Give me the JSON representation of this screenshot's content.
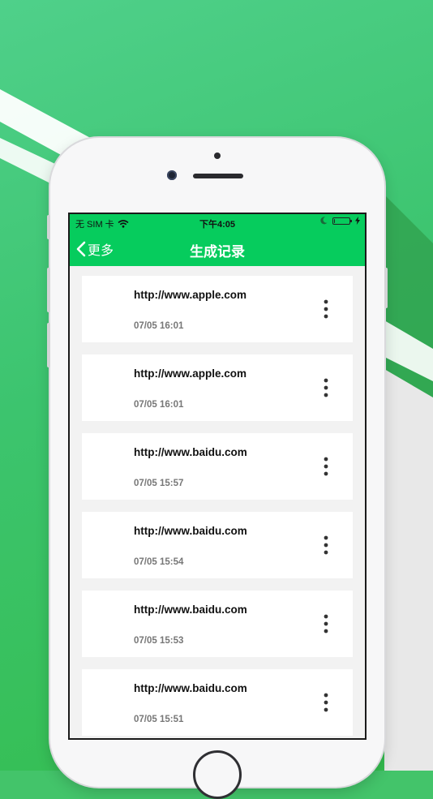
{
  "statusbar": {
    "carrier": "无 SIM 卡",
    "time": "下午4:05",
    "battery_level": 0.05
  },
  "navbar": {
    "back_label": "更多",
    "title": "生成记录"
  },
  "records": [
    {
      "url": "http://www.apple.com",
      "time": "07/05 16:01"
    },
    {
      "url": "http://www.apple.com",
      "time": "07/05 16:01"
    },
    {
      "url": "http://www.baidu.com",
      "time": "07/05 15:57"
    },
    {
      "url": "http://www.baidu.com",
      "time": "07/05 15:54"
    },
    {
      "url": "http://www.baidu.com",
      "time": "07/05 15:53"
    },
    {
      "url": "http://www.baidu.com",
      "time": "07/05 15:51"
    }
  ],
  "colors": {
    "accent": "#06cc5d",
    "background": "#43c46a",
    "card": "#ffffff",
    "list_bg": "#f2f2f2"
  },
  "icons": {
    "back": "chevron-left-icon",
    "more": "more-vertical-icon",
    "wifi": "wifi-icon",
    "moon": "moon-icon",
    "battery": "battery-icon",
    "charging": "bolt-icon"
  }
}
